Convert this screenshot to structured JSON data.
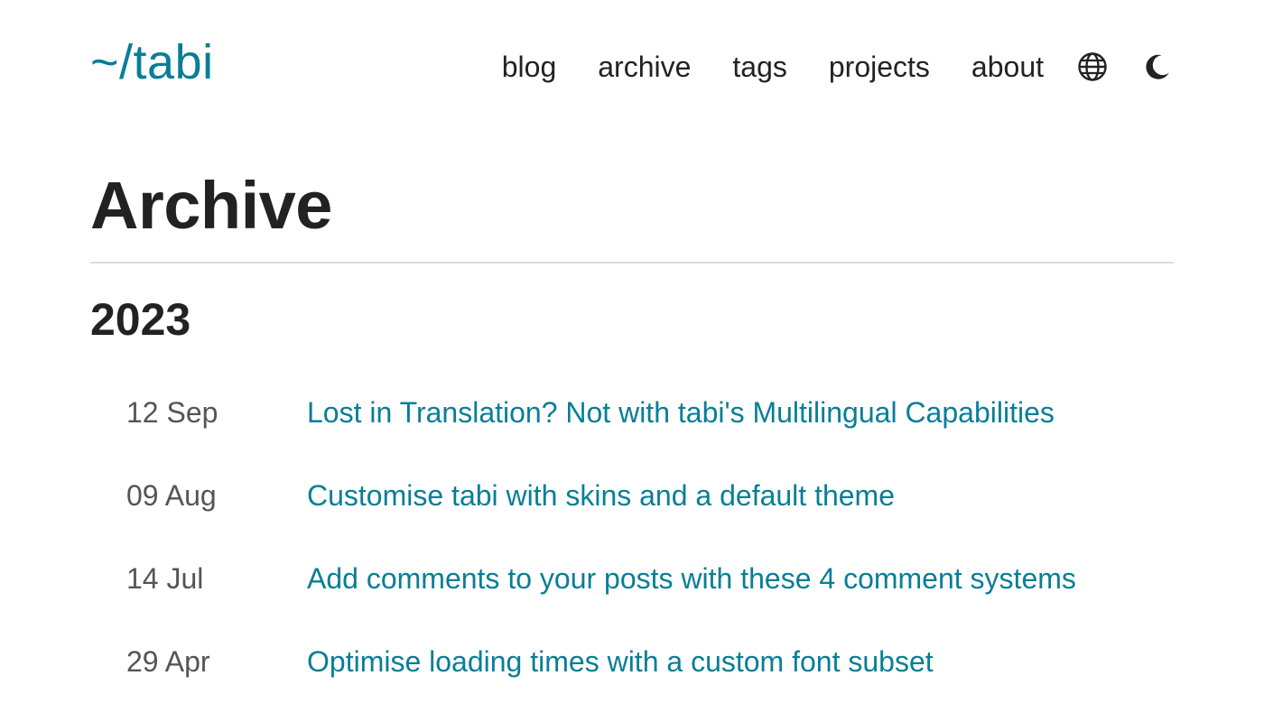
{
  "header": {
    "logo": "~/tabi",
    "nav": [
      {
        "label": "blog"
      },
      {
        "label": "archive"
      },
      {
        "label": "tags"
      },
      {
        "label": "projects"
      },
      {
        "label": "about"
      }
    ],
    "icons": {
      "language": "globe-icon",
      "theme": "moon-icon"
    }
  },
  "main": {
    "title": "Archive",
    "year": "2023",
    "posts": [
      {
        "date": "12 Sep",
        "title": "Lost in Translation? Not with tabi's Multilingual Capabilities"
      },
      {
        "date": "09 Aug",
        "title": "Customise tabi with skins and a default theme"
      },
      {
        "date": "14 Jul",
        "title": "Add comments to your posts with these 4 comment systems"
      },
      {
        "date": "29 Apr",
        "title": "Optimise loading times with a custom font subset"
      }
    ]
  },
  "colors": {
    "accent": "#087e96",
    "text": "#222222",
    "muted": "#555555",
    "divider": "#d9d9d9"
  }
}
